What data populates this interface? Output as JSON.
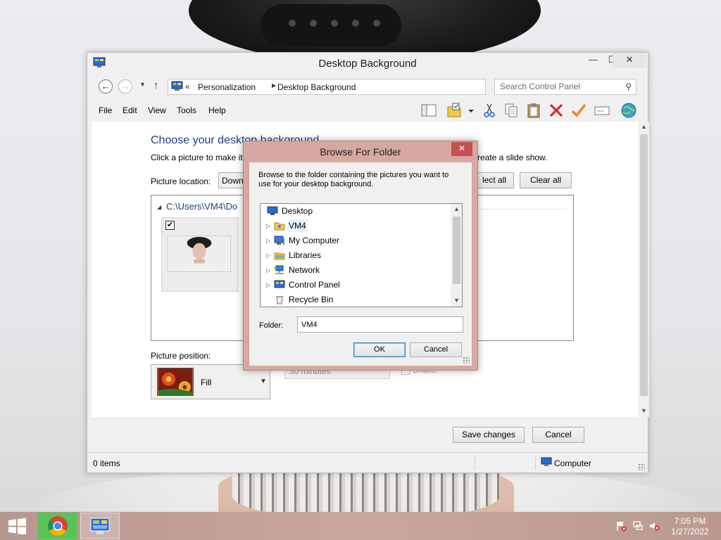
{
  "window": {
    "title": "Desktop Background",
    "controls": {
      "minimize": "—",
      "maximize": "☐",
      "close": "✕"
    }
  },
  "address": {
    "chevrons": "«",
    "crumbs": [
      "Personalization",
      "Desktop Background"
    ],
    "search_placeholder": "Search Control Panel"
  },
  "menu": [
    "File",
    "Edit",
    "View",
    "Tools",
    "Help"
  ],
  "toolbar_icons": [
    "layout-icon",
    "folder-properties-icon",
    "toolbar-dropdown-icon",
    "cut-icon",
    "copy-icon",
    "paste-icon",
    "delete-icon",
    "check-icon",
    "rename-icon",
    "globe-icon"
  ],
  "content": {
    "heading": "Choose your desktop background",
    "subtitle": "Click a picture to make it",
    "subtitle_right": "reate a slide show.",
    "picture_location_label": "Picture location:",
    "picture_location_value": "Down",
    "select_all": "lect all",
    "clear_all": "Clear all",
    "gallery_path": "C:\\Users\\VM4\\Do",
    "thumbnail_checked": true,
    "picture_position_label": "Picture position:",
    "picture_position_value": "Fill",
    "interval_value": "30 minutes",
    "shuffle_label": "Shufle"
  },
  "footer": {
    "save": "Save changes",
    "cancel": "Cancel"
  },
  "status": {
    "items": "0 items",
    "location": "Computer"
  },
  "dialog": {
    "title": "Browse For Folder",
    "description": "Browse to the folder containing the pictures you want to use for your desktop background.",
    "tree": [
      {
        "label": "Desktop",
        "icon": "desktop-icon",
        "expandable": false,
        "selected": false
      },
      {
        "label": "VM4",
        "icon": "user-folder-icon",
        "expandable": true,
        "selected": true
      },
      {
        "label": "My Computer",
        "icon": "computer-icon",
        "expandable": true,
        "selected": false
      },
      {
        "label": "Libraries",
        "icon": "libraries-icon",
        "expandable": true,
        "selected": false
      },
      {
        "label": "Network",
        "icon": "network-icon",
        "expandable": true,
        "selected": false
      },
      {
        "label": "Control Panel",
        "icon": "control-panel-icon",
        "expandable": true,
        "selected": false
      },
      {
        "label": "Recycle Bin",
        "icon": "recycle-bin-icon",
        "expandable": false,
        "selected": false
      }
    ],
    "folder_label": "Folder:",
    "folder_value": "VM4",
    "ok": "OK",
    "cancel": "Cancel"
  },
  "taskbar": {
    "apps": [
      "chrome-icon",
      "control-panel-icon"
    ],
    "time": "7:05 PM",
    "date": "1/27/2022"
  },
  "colors": {
    "heading": "#1e3f84",
    "dialog_frame": "#d7a7a1",
    "dialog_close": "#c75050",
    "taskbar": "#c9a79f"
  }
}
